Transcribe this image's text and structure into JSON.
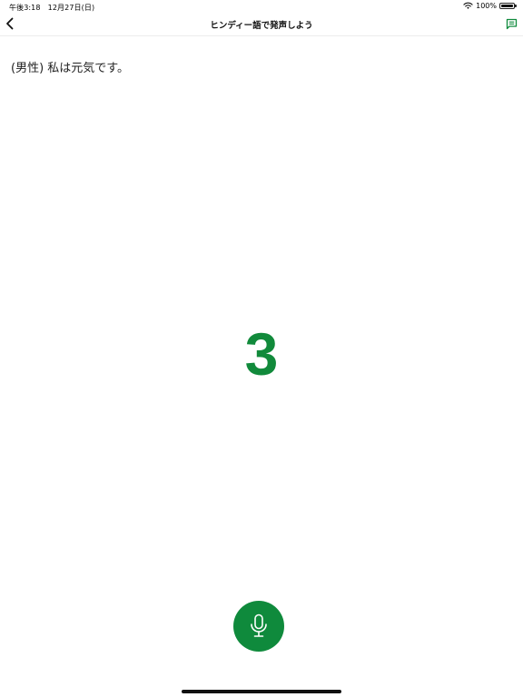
{
  "status_bar": {
    "time": "午後3:18　12月27日(日)",
    "battery_percent": "100%",
    "battery_level": 1.0
  },
  "nav": {
    "title": "ヒンディー語で発声しよう",
    "back_icon": "chevron-left-icon",
    "chat_icon": "chat-bubble-icon"
  },
  "phrase": {
    "text": "(男性) 私は元気です。"
  },
  "countdown": {
    "value": "3"
  },
  "mic": {
    "icon": "microphone-icon"
  },
  "colors": {
    "accent_green": "#0f8a3c",
    "countdown_green": "#118a3b"
  }
}
